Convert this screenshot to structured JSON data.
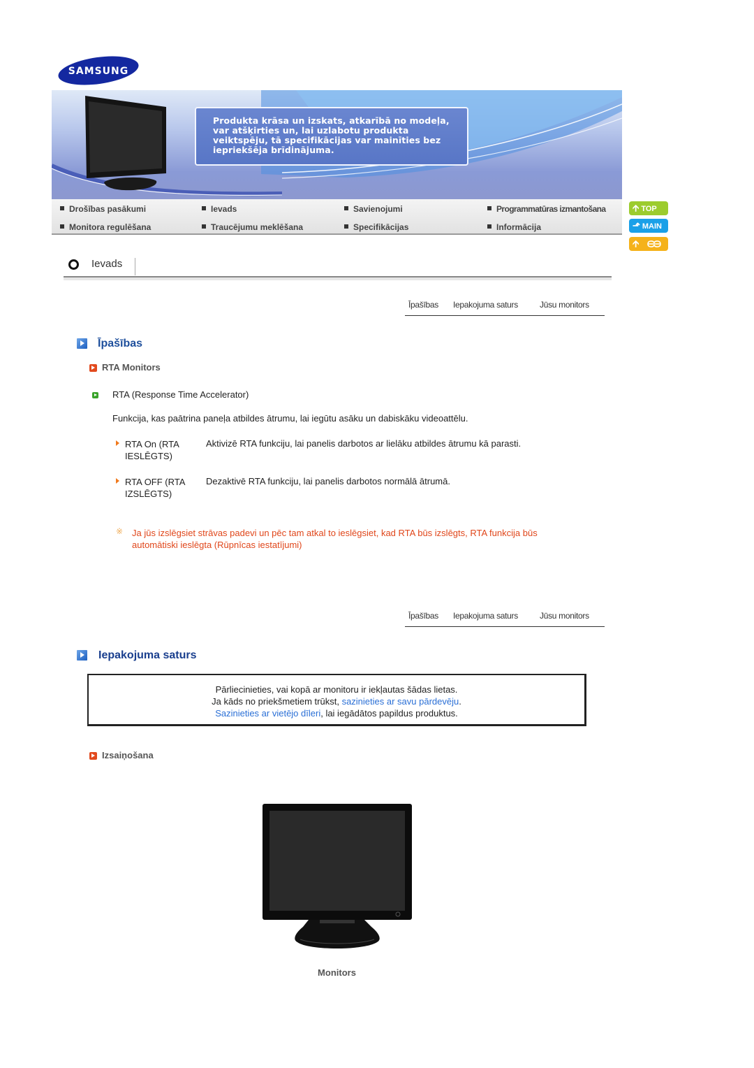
{
  "brand": {
    "logo_text": "SAMSUNG",
    "logo_color": "#1428a0"
  },
  "banner": {
    "note": "Produkta krāsa un izskats, atkarībā no modeļa, var atšķirties un, lai uzlabotu produkta veiktspēju, tā specifikācijas var mainīties bez iepriekšēja brīdinājuma."
  },
  "nav": {
    "items": [
      {
        "label": "Drošības pasākumi"
      },
      {
        "label": "Ievads"
      },
      {
        "label": "Savienojumi"
      },
      {
        "label": "Programmatūras izmantošana"
      },
      {
        "label": "Monitora regulēšana"
      },
      {
        "label": "Traucējumu meklēšana"
      },
      {
        "label": "Specifikācijas"
      },
      {
        "label": "Informācija"
      }
    ]
  },
  "side_buttons": {
    "top": {
      "label": "TOP",
      "color": "#9ccc2e"
    },
    "main": {
      "label": "MAIN",
      "color": "#1aa0e8"
    },
    "back": {
      "label": "",
      "color": "#f5b21a"
    }
  },
  "section": {
    "title": "Ievads"
  },
  "subnav": {
    "items": [
      {
        "label": "Īpašības"
      },
      {
        "label": "Iepakojuma saturs"
      },
      {
        "label": "Jūsu monitors"
      }
    ]
  },
  "features": {
    "heading": "Īpašības",
    "subheading": "RTA Monitors",
    "item_title": "RTA (Response Time Accelerator)",
    "description": "Funkcija, kas paātrina paneļa atbildes ātrumu, lai iegūtu asāku un dabiskāku videoattēlu.",
    "modes": [
      {
        "term": "RTA On (RTA IESLĒGTS)",
        "definition": "Aktivizē RTA funkciju, lai panelis darbotos ar lielāku atbildes ātrumu kā parasti."
      },
      {
        "term": "RTA OFF (RTA IZSLĒGTS)",
        "definition": "Dezaktivē RTA funkciju, lai panelis darbotos normālā ātrumā."
      }
    ],
    "warning": "Ja jūs izslēgsiet strāvas padevi un pēc tam atkal to ieslēgsiet, kad RTA būs izslēgts, RTA funkcija būs automātiski ieslēgta (Rūpnīcas iestatījumi)"
  },
  "package": {
    "heading": "Iepakojuma saturs",
    "box": {
      "line1": "Pārliecinieties, vai kopā ar monitoru ir iekļautas šādas lietas.",
      "line2_prefix": "Ja kāds no priekšmetiem trūkst, ",
      "line2_link": "sazinieties ar savu pārdevēju",
      "line2_suffix": ".",
      "line3_link": "Sazinieties ar vietējo dīleri",
      "line3_suffix": ", lai iegādātos papildus produktus."
    },
    "subheading": "Izsaiņošana",
    "item_caption": "Monitors"
  },
  "colors": {
    "heading_blue": "#1e4f9c",
    "warning_red": "#e0461a",
    "link_blue": "#2a6fd6"
  }
}
